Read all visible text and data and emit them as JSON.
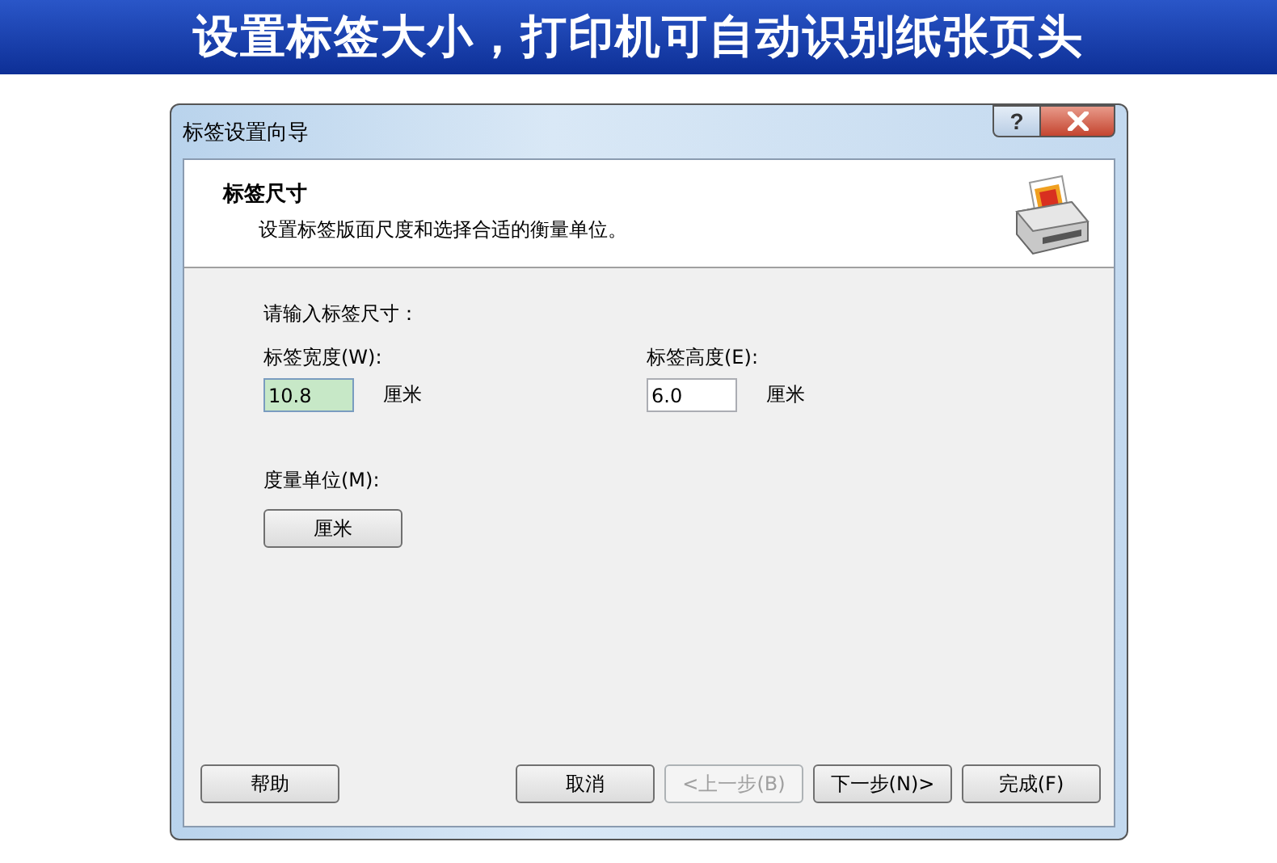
{
  "banner": {
    "text": "设置标签大小，打印机可自动识别纸张页头"
  },
  "window": {
    "title": "标签设置向导",
    "help_glyph": "?"
  },
  "header": {
    "title": "标签尺寸",
    "subtitle": "设置标签版面尺度和选择合适的衡量单位。"
  },
  "prompt": "请输入标签尺寸：",
  "fields": [
    {
      "label": "标签宽度(W):",
      "value": "10.8",
      "unit": "厘米",
      "focused": true
    },
    {
      "label": "标签高度(E):",
      "value": "6.0",
      "unit": "厘米",
      "focused": false
    }
  ],
  "measure": {
    "label": "度量单位(M):",
    "button": "厘米"
  },
  "buttons": [
    {
      "label": "帮助",
      "kind": "help",
      "disabled": false
    },
    {
      "label": "取消",
      "kind": "nav",
      "disabled": false
    },
    {
      "label": "<上一步(B)",
      "kind": "nav",
      "disabled": true
    },
    {
      "label": "下一步(N)>",
      "kind": "nav",
      "disabled": false
    },
    {
      "label": "完成(F)",
      "kind": "nav",
      "disabled": false
    }
  ]
}
